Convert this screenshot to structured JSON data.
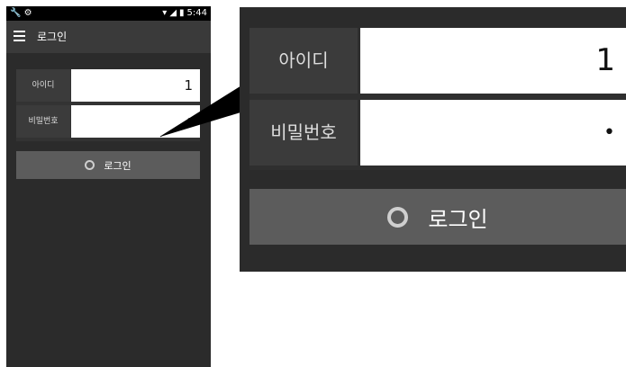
{
  "statusbar": {
    "left_icons": [
      "wrench-icon",
      "android-debug-icon"
    ],
    "time": "5:44",
    "right_icons": [
      "wifi-icon",
      "signal-icon",
      "battery-icon"
    ]
  },
  "appbar": {
    "title": "로그인",
    "menu_icon": "hamburger-menu-icon"
  },
  "form": {
    "id_label": "아이디",
    "id_value": "1",
    "password_label": "비밀번호",
    "password_value": "•"
  },
  "login_button": {
    "label": "로그인",
    "icon": "ring-icon"
  },
  "colors": {
    "app_background": "#2b2b2b",
    "appbar": "#3a3a3a",
    "label_cell": "#3b3b3b",
    "button": "#5c5c5c",
    "input": "#ffffff"
  }
}
